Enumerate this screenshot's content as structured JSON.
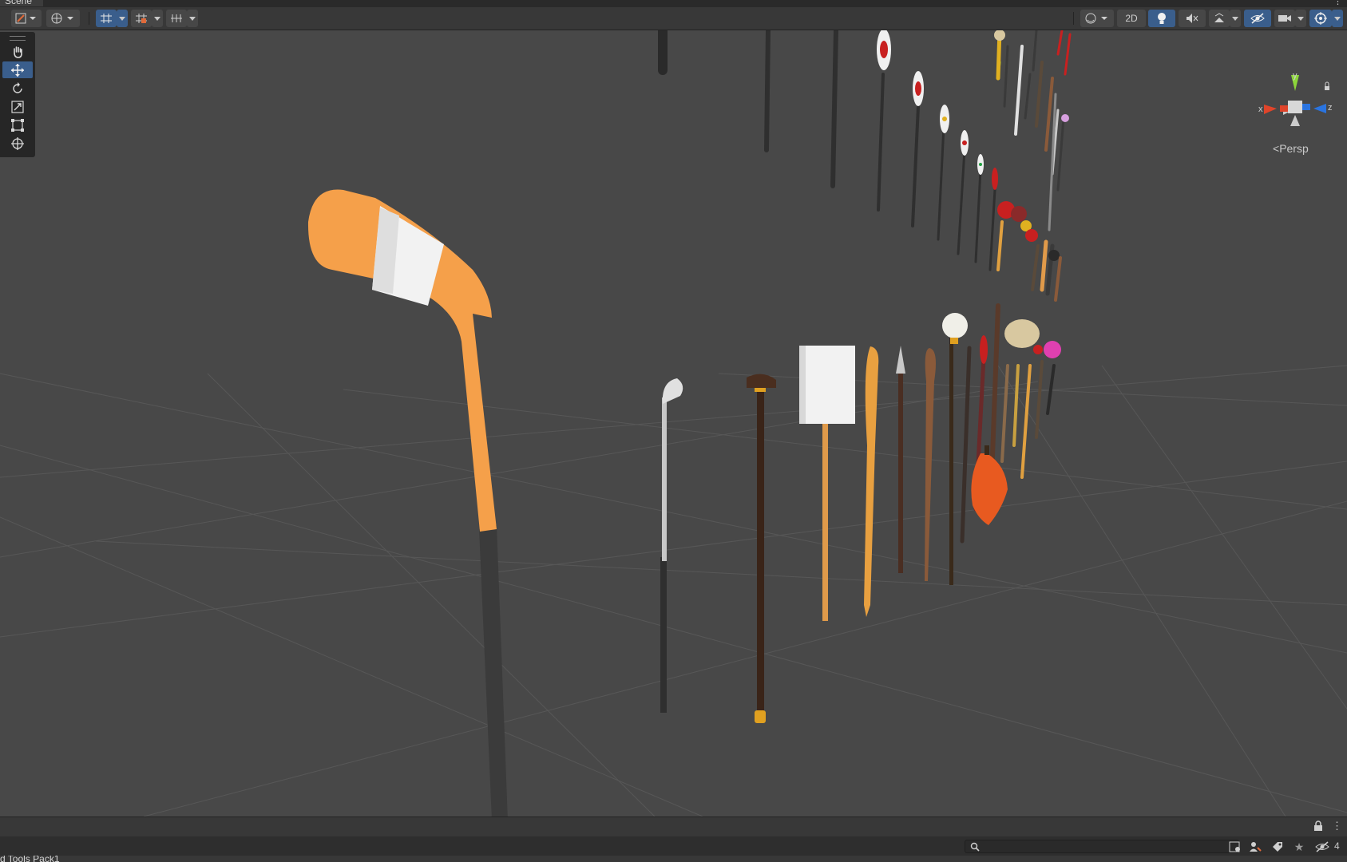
{
  "window": {
    "tab_title": "Scene"
  },
  "toolbar": {
    "mode_2d_label": "2D"
  },
  "scene": {
    "camera_mode_label": "Persp",
    "gizmo": {
      "axis_y": "y",
      "axis_x": "x",
      "axis_z": "z"
    }
  },
  "footer": {
    "breadcrumb": "d Tools Pack1",
    "search": {
      "placeholder": ""
    },
    "hidden_count": "4"
  },
  "colors": {
    "accent_blue": "#3a5e8c",
    "viewport_bg": "#484848",
    "hockey_stick": "#f5a04a",
    "axis_x": "#e0442a",
    "axis_y": "#8cd63a",
    "axis_z": "#2a74e0"
  },
  "icons": [
    "move-tool-icon",
    "hand-tool-icon",
    "rotate-tool-icon",
    "scale-tool-icon",
    "rect-tool-icon",
    "transform-tool-icon",
    "grid-icon",
    "snap-icon",
    "globe-icon",
    "light-icon",
    "audio-icon",
    "effects-icon",
    "visibility-icon",
    "camera-icon",
    "gizmo-icon",
    "lock-icon",
    "search-icon",
    "star-icon",
    "tag-icon"
  ]
}
